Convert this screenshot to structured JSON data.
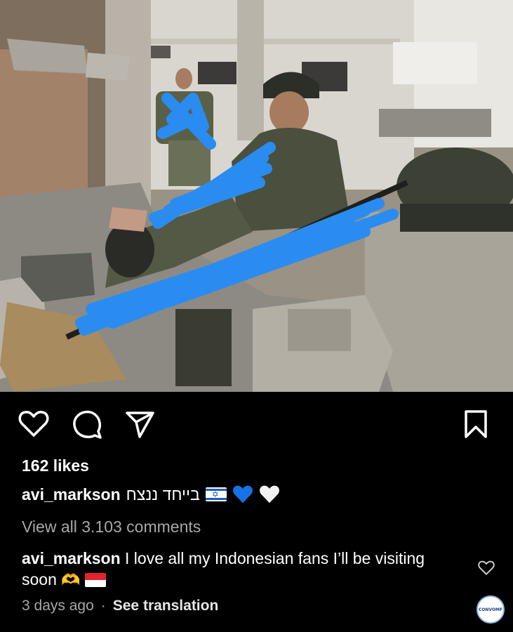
{
  "post": {
    "likes": "162 likes",
    "caption": {
      "username": "avi_markson",
      "text": "בייחד ננצח"
    },
    "view_comments": "View all 3.103 comments",
    "comment": {
      "username": "avi_markson",
      "text": "I love all my Indonesian fans I’ll be visiting soon"
    },
    "time": "3 days ago",
    "dot": "·",
    "see_translation": "See translation"
  },
  "watermark": "CONVOMF",
  "icons": [
    "heart-icon",
    "comment-icon",
    "share-icon",
    "bookmark-icon",
    "israel-flag-icon",
    "blue-heart-icon",
    "white-heart-icon",
    "heart-hands-icon",
    "indonesia-flag-icon",
    "comment-like-icon"
  ],
  "colors": {
    "background": "#000000",
    "muted_text": "#a8a8a8",
    "scribble": "#2a8cf0"
  }
}
